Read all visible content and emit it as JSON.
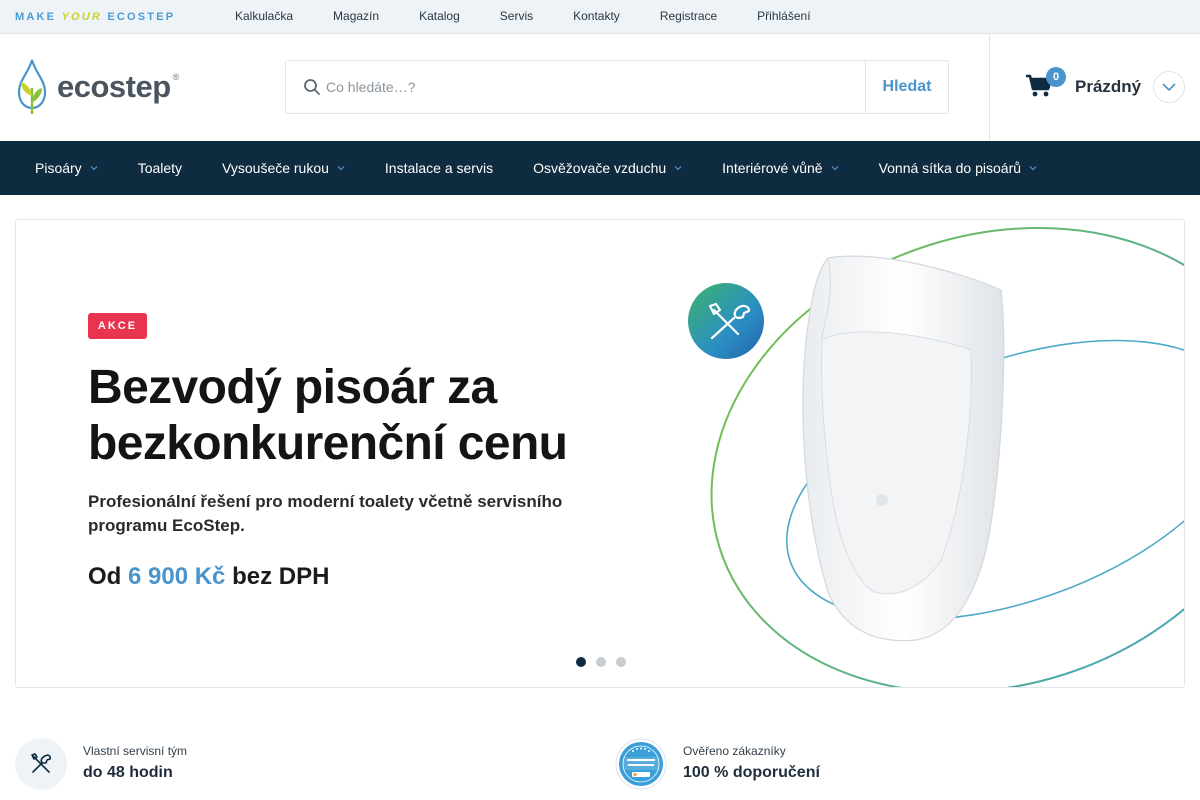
{
  "topbar": {
    "tagline_make": "MAKE",
    "tagline_your": "YOUR",
    "tagline_brand": "ECOSTEP",
    "links": [
      "Kalkulačka",
      "Magazín",
      "Katalog",
      "Servis",
      "Kontakty",
      "Registrace",
      "Přihlášení"
    ]
  },
  "header": {
    "logo_text": "ecostep",
    "logo_reg": "®",
    "search_placeholder": "Co hledáte…?",
    "search_button": "Hledat",
    "cart_count": "0",
    "cart_label": "Prázdný"
  },
  "nav": {
    "items": [
      {
        "label": "Pisoáry",
        "has_dropdown": true
      },
      {
        "label": "Toalety",
        "has_dropdown": false
      },
      {
        "label": "Vysoušeče rukou",
        "has_dropdown": true
      },
      {
        "label": "Instalace a servis",
        "has_dropdown": false
      },
      {
        "label": "Osvěžovače vzduchu",
        "has_dropdown": true
      },
      {
        "label": "Interiérové vůně",
        "has_dropdown": true
      },
      {
        "label": "Vonná sítka do pisoárů",
        "has_dropdown": true
      }
    ]
  },
  "banner": {
    "badge": "AKCE",
    "headline_line1": "Bezvodý pisoár za",
    "headline_line2": "bezkonkurenční cenu",
    "subline_line1": "Profesionální řešení pro moderní toalety včetně servisního",
    "subline_line2": "programu EcoStep.",
    "price_prefix": "Od",
    "price_amount": "6 900 Kč",
    "price_suffix": "bez DPH",
    "slides_total": 3,
    "active_slide": 1
  },
  "features": [
    {
      "small": "Vlastní servisní tým",
      "big": "do 48 hodin",
      "icon": "tools-icon"
    },
    {
      "small": "Ověřeno zákazníky",
      "big": "100 % doporučení",
      "icon": "heureka-badge-icon"
    }
  ],
  "colors": {
    "nav_bg": "#0f2b40",
    "accent": "#4a94cc",
    "badge_red": "#e8344e",
    "leaf_green": "#c8d32c"
  }
}
